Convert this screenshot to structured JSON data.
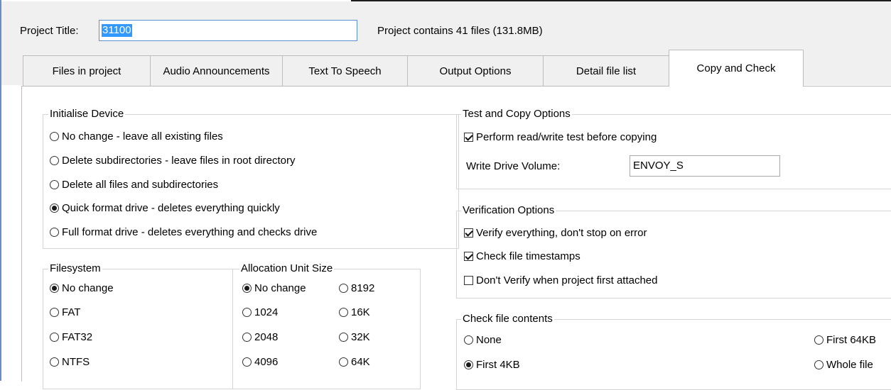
{
  "header": {
    "project_title_label": "Project Title:",
    "project_title_value": "31100",
    "project_summary": "Project contains 41 files (131.8MB)"
  },
  "tabs": [
    {
      "label": "Files in project"
    },
    {
      "label": "Audio Announcements"
    },
    {
      "label": "Text To Speech"
    },
    {
      "label": "Output Options"
    },
    {
      "label": "Detail file list"
    },
    {
      "label": "Copy and Check",
      "active": true
    }
  ],
  "initialise_device": {
    "title": "Initialise Device",
    "options": [
      {
        "label": "No change - leave all existing files",
        "selected": false
      },
      {
        "label": "Delete subdirectories - leave files in root directory",
        "selected": false
      },
      {
        "label": "Delete all files and subdirectories",
        "selected": false
      },
      {
        "label": "Quick format drive - deletes everything quickly",
        "selected": true
      },
      {
        "label": "Full format drive - deletes everything and checks drive",
        "selected": false
      }
    ]
  },
  "filesystem": {
    "title": "Filesystem",
    "options": [
      {
        "label": "No change",
        "selected": true
      },
      {
        "label": "FAT",
        "selected": false
      },
      {
        "label": "FAT32",
        "selected": false
      },
      {
        "label": "NTFS",
        "selected": false
      }
    ]
  },
  "allocation_unit_size": {
    "title": "Allocation Unit Size",
    "options": [
      {
        "label": "No change",
        "selected": true
      },
      {
        "label": "8192",
        "selected": false
      },
      {
        "label": "1024",
        "selected": false
      },
      {
        "label": "16K",
        "selected": false
      },
      {
        "label": "2048",
        "selected": false
      },
      {
        "label": "32K",
        "selected": false
      },
      {
        "label": "4096",
        "selected": false
      },
      {
        "label": "64K",
        "selected": false
      }
    ]
  },
  "test_copy": {
    "title": "Test and Copy Options",
    "perform_test": {
      "label": "Perform read/write test before copying",
      "checked": true
    },
    "write_volume_label": "Write Drive Volume:",
    "write_volume_value": "ENVOY_S"
  },
  "verification": {
    "title": "Verification Options",
    "options": [
      {
        "label": "Verify everything, don't stop on error",
        "checked": true
      },
      {
        "label": "Check file timestamps",
        "checked": true
      },
      {
        "label": "Don't Verify when project first attached",
        "checked": false
      }
    ]
  },
  "check_contents": {
    "title": "Check file contents",
    "options": [
      {
        "label": "None",
        "selected": false
      },
      {
        "label": "First 64KB",
        "selected": false
      },
      {
        "label": "First 4KB",
        "selected": true
      },
      {
        "label": "Whole file",
        "selected": false
      }
    ]
  }
}
